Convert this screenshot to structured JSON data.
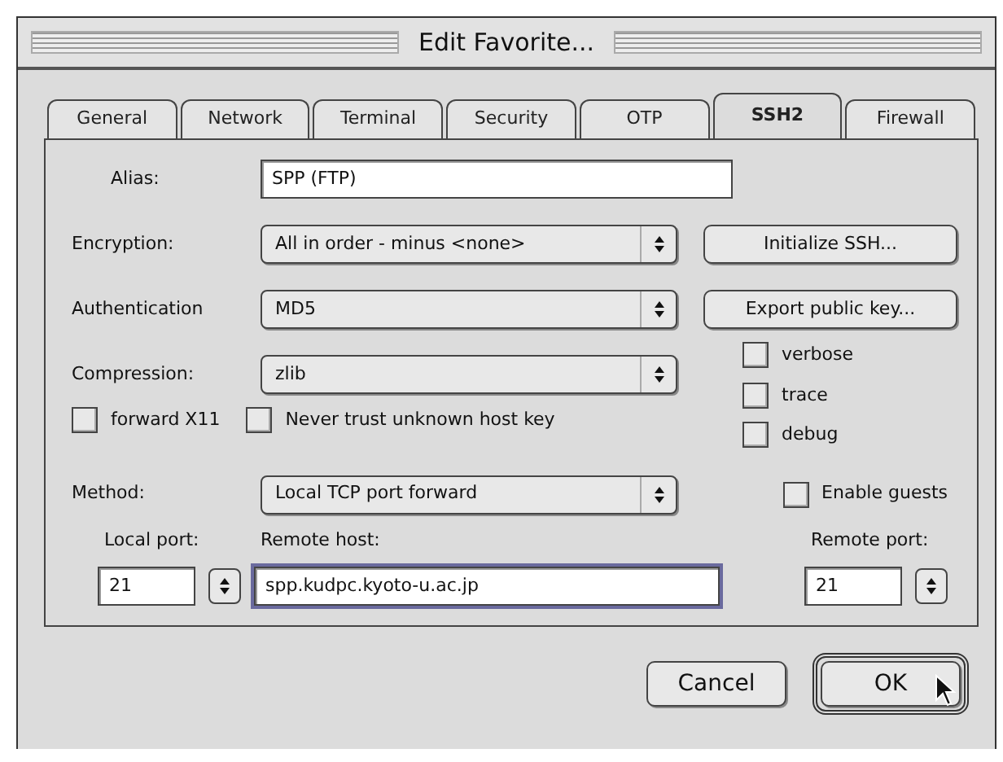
{
  "window": {
    "title": "Edit Favorite..."
  },
  "tabs": [
    {
      "label": "General",
      "selected": false
    },
    {
      "label": "Network",
      "selected": false
    },
    {
      "label": "Terminal",
      "selected": false
    },
    {
      "label": "Security",
      "selected": false
    },
    {
      "label": "OTP",
      "selected": false
    },
    {
      "label": "SSH2",
      "selected": true
    },
    {
      "label": "Firewall",
      "selected": false
    }
  ],
  "alias": {
    "label": "Alias:",
    "value": "SPP (FTP)"
  },
  "popups": [
    {
      "label": "Encryption:",
      "value": "All in order - minus <none>"
    },
    {
      "label": "Authentication",
      "value": "MD5"
    },
    {
      "label": "Compression:",
      "value": "zlib"
    }
  ],
  "side_buttons": [
    "Initialize SSH...",
    "Export public key..."
  ],
  "debug_options": [
    {
      "label": "verbose",
      "checked": false
    },
    {
      "label": "trace",
      "checked": false
    },
    {
      "label": "debug",
      "checked": false
    }
  ],
  "options": [
    {
      "label": "forward X11",
      "checked": false
    },
    {
      "label": "Never trust unknown host key",
      "checked": false
    }
  ],
  "method": {
    "label": "Method:",
    "value": "Local TCP port forward"
  },
  "enable_guests": {
    "label": "Enable guests",
    "checked": false
  },
  "local_port": {
    "label": "Local port:",
    "value": "21",
    "focused": false
  },
  "remote_host": {
    "label": "Remote host:",
    "value": "spp.kudpc.kyoto-u.ac.jp",
    "focused": true
  },
  "remote_port": {
    "label": "Remote port:",
    "value": "21",
    "focused": false
  },
  "buttons": [
    {
      "label": "Cancel",
      "default": false
    },
    {
      "label": "OK",
      "default": true
    }
  ]
}
